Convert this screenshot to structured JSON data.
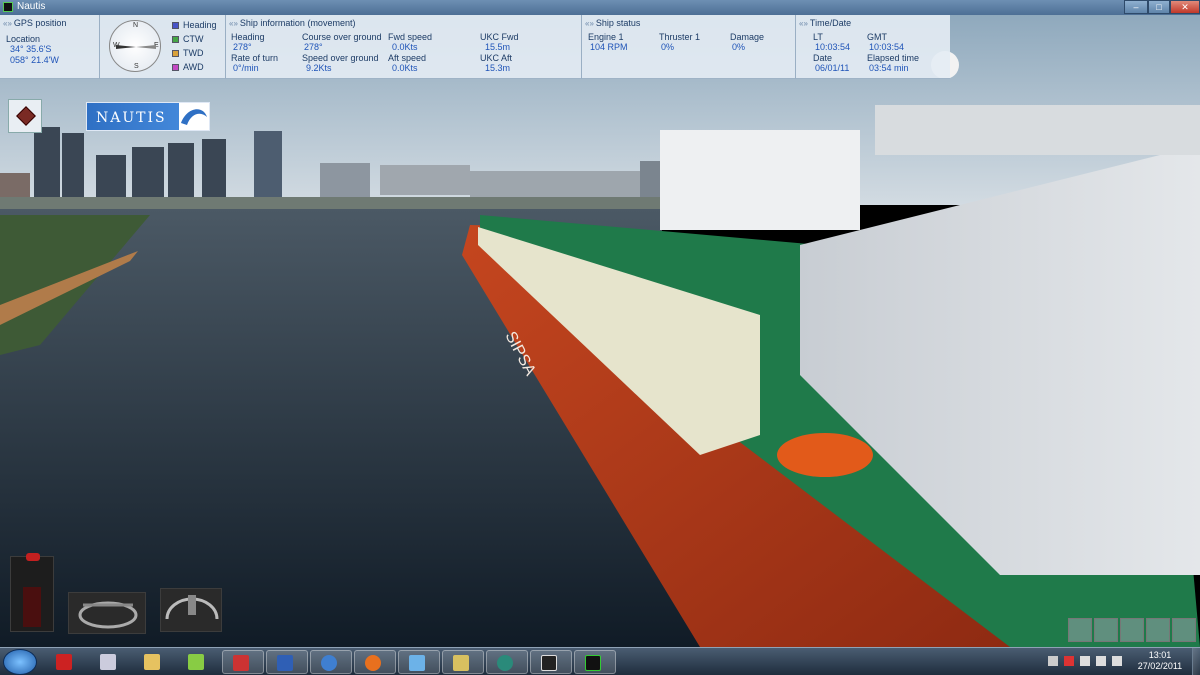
{
  "window": {
    "title": "Nautis",
    "min": "–",
    "max": "□",
    "close": "✕"
  },
  "hud": {
    "gps": {
      "title": "GPS position",
      "location_label": "Location",
      "lat": "34° 35.6'S",
      "lon": "058° 21.4'W"
    },
    "compass_legend": {
      "heading": "Heading",
      "ctw": "CTW",
      "twd": "TWD",
      "awd": "AWD",
      "colors": {
        "heading": "#4a55c8",
        "ctw": "#46a646",
        "twd": "#d9a13a",
        "awd": "#c44ac4"
      }
    },
    "movement": {
      "title": "Ship information (movement)",
      "heading_label": "Heading",
      "heading": "278°",
      "rot_label": "Rate of turn",
      "rot": "0°/min",
      "cog_label": "Course over ground",
      "cog": "278°",
      "sog_label": "Speed over ground",
      "sog": "9.2Kts",
      "fwd_label": "Fwd speed",
      "fwd": "0.0Kts",
      "aft_label": "Aft speed",
      "aft": "0.0Kts",
      "ukc_fwd_label": "UKC Fwd",
      "ukc_fwd": "15.5m",
      "ukc_aft_label": "UKC Aft",
      "ukc_aft": "15.3m"
    },
    "status": {
      "title": "Ship status",
      "engine_label": "Engine 1",
      "engine": "104 RPM",
      "thruster_label": "Thruster 1",
      "thruster": "0%",
      "damage_label": "Damage",
      "damage": "0%"
    },
    "time": {
      "title": "Time/Date",
      "lt_label": "LT",
      "lt": "10:03:54",
      "gmt_label": "GMT",
      "gmt": "10:03:54",
      "date_label": "Date",
      "date": "06/01/11",
      "elapsed_label": "Elapsed time",
      "elapsed": "03:54 min"
    }
  },
  "compass": {
    "n": "N",
    "s": "S",
    "e": "E",
    "w": "W"
  },
  "logo": {
    "text": "NAUTIS"
  },
  "ship": {
    "name": "SIPSA"
  },
  "taskbar": {
    "clock_time": "13:01",
    "clock_date": "27/02/2011"
  }
}
